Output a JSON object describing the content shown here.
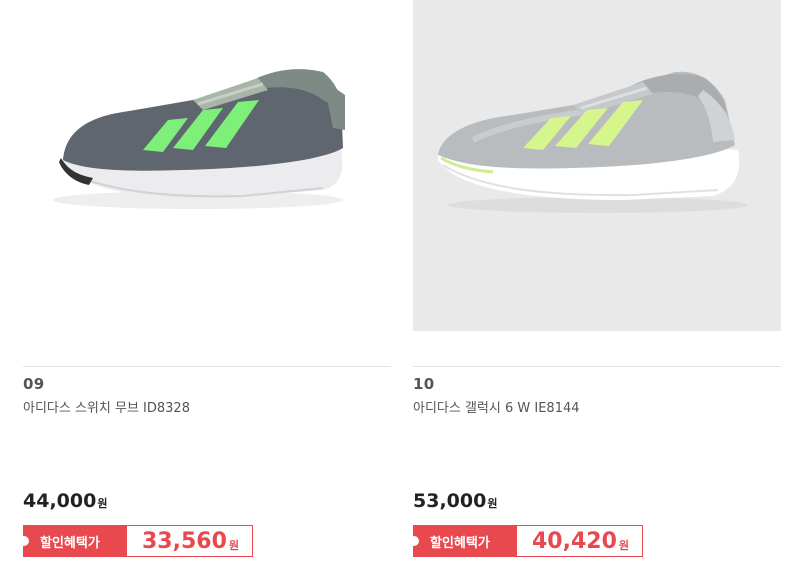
{
  "products": [
    {
      "rank": "09",
      "name": "아디다스 스위치 무브 ID8328",
      "price": "44,000",
      "price_unit": "원",
      "benefit_label": "할인혜택가",
      "benefit_price": "33,560",
      "benefit_unit": "원",
      "image": "grey-shoe-with-green-stripes",
      "image_bg": "#ffffff"
    },
    {
      "rank": "10",
      "name": "아디다스 갤럭시 6 W IE8144",
      "price": "53,000",
      "price_unit": "원",
      "benefit_label": "할인혜택가",
      "benefit_price": "40,420",
      "benefit_unit": "원",
      "image": "light-grey-shoe-with-lime-stripes",
      "image_bg": "#e9e9e9"
    }
  ],
  "colors": {
    "accent_red": "#e8494e",
    "shoe1_upper": "#5f6670",
    "shoe1_stripe": "#7ef07a",
    "shoe2_upper": "#b9bcbf",
    "shoe2_stripe": "#d6f58c"
  }
}
